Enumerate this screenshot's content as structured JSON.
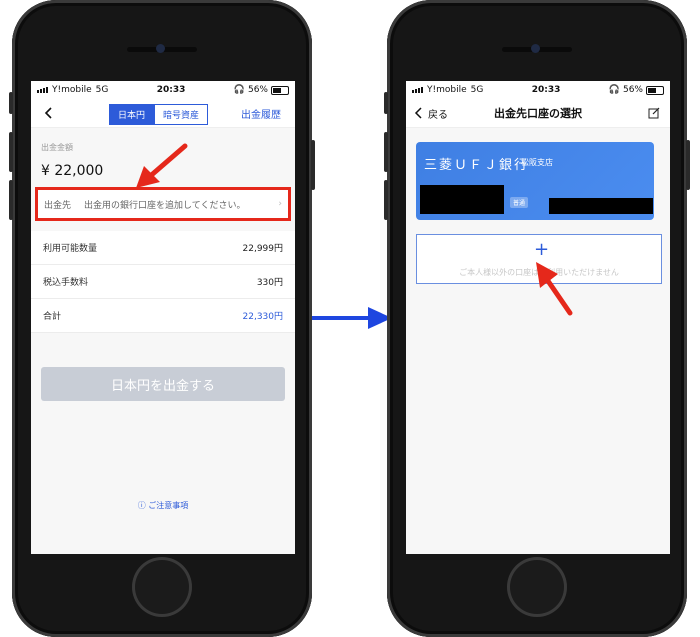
{
  "colors": {
    "accent_blue": "#2d5bd9",
    "highlight_red": "#e5281b",
    "card_blue": "#3f7fe3",
    "flow_arrow": "#1e46e0"
  },
  "left_phone": {
    "status": {
      "carrier": "Y!mobile",
      "network": "5G",
      "time": "20:33",
      "battery": "56%",
      "battery_level": 0.56
    },
    "nav": {
      "tab_jpy": "日本円",
      "tab_crypto": "暗号資産",
      "history": "出金履歴"
    },
    "amount_label": "出金金額",
    "amount_value": "¥ 22,000",
    "destination": {
      "label": "出金先",
      "placeholder": "出金用の銀行口座を追加してください。"
    },
    "rows": [
      {
        "label": "利用可能数量",
        "value": "22,999円"
      },
      {
        "label": "税込手数料",
        "value": "330円"
      },
      {
        "label": "合計",
        "value": "22,330円"
      }
    ],
    "cta": "日本円を出金する",
    "notice": "ご注意事項"
  },
  "right_phone": {
    "status": {
      "carrier": "Y!mobile",
      "network": "5G",
      "time": "20:33",
      "battery": "56%",
      "battery_level": 0.56
    },
    "nav": {
      "back": "戻る",
      "title": "出金先口座の選択"
    },
    "bank_card": {
      "bank_name": "三菱ＵＦＪ銀行",
      "branch": "松阪支店",
      "account_type": "普通"
    },
    "add_account": {
      "plus": "+",
      "note": "ご本人様以外の口座はご利用いただけません"
    }
  }
}
